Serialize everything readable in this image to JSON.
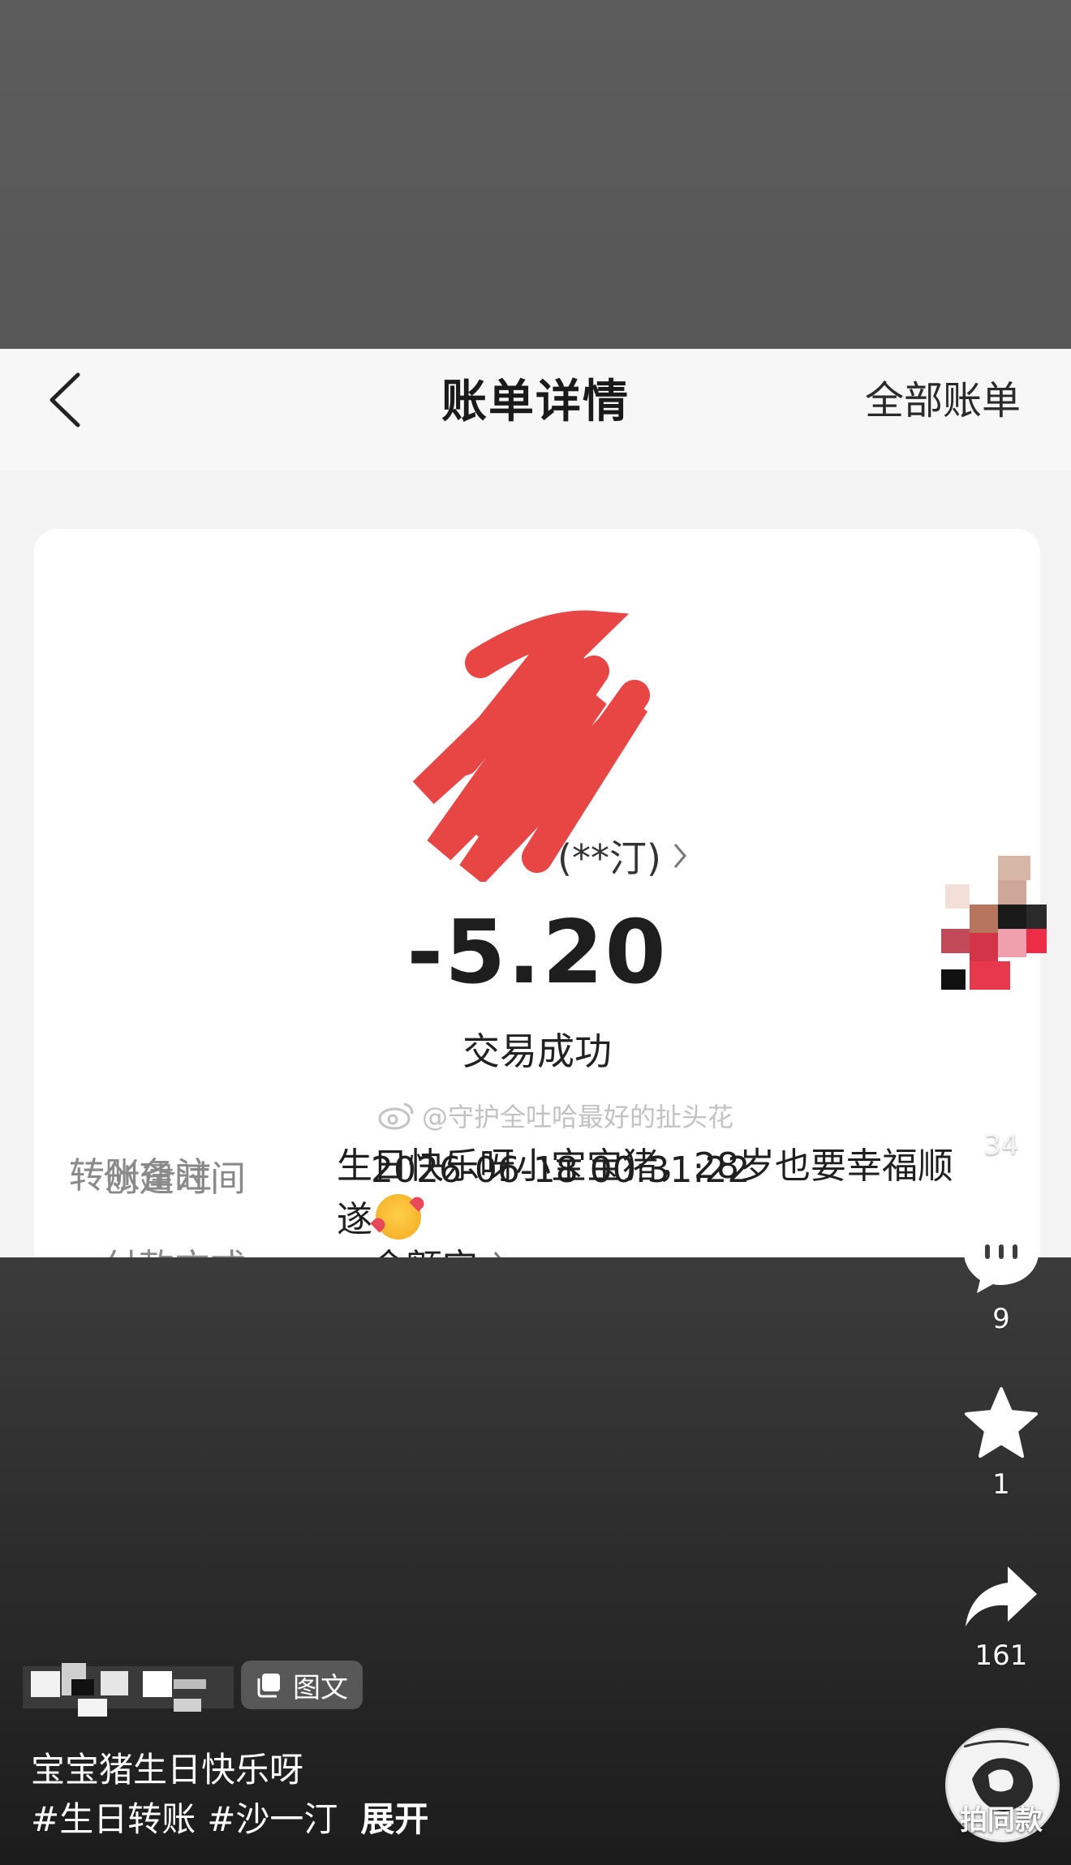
{
  "bill": {
    "title": "账单详情",
    "all_bills": "全部账单",
    "payee": "(**汀)",
    "amount": "-5.20",
    "status": "交易成功",
    "watermark": "@守护全吐哈最好的扯头花",
    "rows": {
      "created_label": "创建时间",
      "created_value": "2026-06-18 00:31:22",
      "method_label": "付款方式",
      "method_value": "余额宝",
      "memo_label": "转账备注",
      "memo_value": "生日快乐呀小宝宝猪，28岁也要幸福顺遂"
    },
    "colors": {
      "scribble": "#e84545"
    }
  },
  "rail": {
    "likes": "34",
    "comments": "9",
    "favorites": "1",
    "shares": "161",
    "make_same": "拍同款",
    "icons": [
      "heart-icon",
      "comment-icon",
      "star-icon",
      "share-icon"
    ]
  },
  "post": {
    "type_badge": "图文",
    "caption": "宝宝猪生日快乐呀",
    "tags": [
      "#生日转账",
      "#沙一汀"
    ],
    "expand": "展开"
  }
}
